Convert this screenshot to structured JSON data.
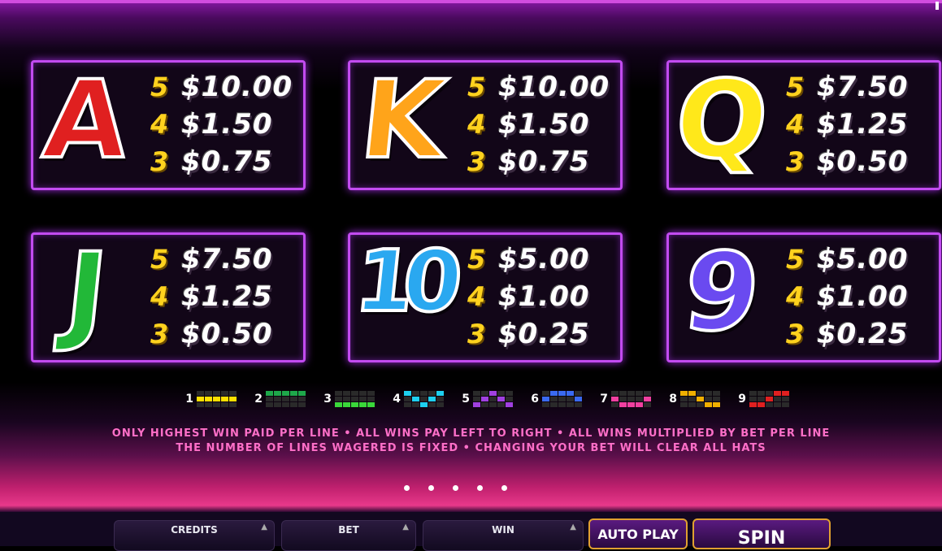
{
  "paytable": [
    {
      "symbol": "A",
      "color": "#e02020",
      "pays": [
        {
          "count": "5",
          "amount": "$10.00"
        },
        {
          "count": "4",
          "amount": "$1.50"
        },
        {
          "count": "3",
          "amount": "$0.75"
        }
      ]
    },
    {
      "symbol": "K",
      "color": "#ffa41a",
      "pays": [
        {
          "count": "5",
          "amount": "$10.00"
        },
        {
          "count": "4",
          "amount": "$1.50"
        },
        {
          "count": "3",
          "amount": "$0.75"
        }
      ]
    },
    {
      "symbol": "Q",
      "color": "#ffe81a",
      "pays": [
        {
          "count": "5",
          "amount": "$7.50"
        },
        {
          "count": "4",
          "amount": "$1.25"
        },
        {
          "count": "3",
          "amount": "$0.50"
        }
      ]
    },
    {
      "symbol": "J",
      "color": "#22b838",
      "pays": [
        {
          "count": "5",
          "amount": "$7.50"
        },
        {
          "count": "4",
          "amount": "$1.25"
        },
        {
          "count": "3",
          "amount": "$0.50"
        }
      ]
    },
    {
      "symbol": "10",
      "color": "#2aa8f0",
      "pays": [
        {
          "count": "5",
          "amount": "$5.00"
        },
        {
          "count": "4",
          "amount": "$1.00"
        },
        {
          "count": "3",
          "amount": "$0.25"
        }
      ]
    },
    {
      "symbol": "9",
      "color": "#6a4af0",
      "pays": [
        {
          "count": "5",
          "amount": "$5.00"
        },
        {
          "count": "4",
          "amount": "$1.00"
        },
        {
          "count": "3",
          "amount": "$0.25"
        }
      ]
    }
  ],
  "paylines": [
    {
      "number": "1",
      "color": "#ffe000",
      "pattern": [
        1,
        1,
        1,
        1,
        1
      ]
    },
    {
      "number": "2",
      "color": "#1ea84a",
      "pattern": [
        0,
        0,
        0,
        0,
        0
      ]
    },
    {
      "number": "3",
      "color": "#3ad83a",
      "pattern": [
        2,
        2,
        2,
        2,
        2
      ]
    },
    {
      "number": "4",
      "color": "#1ed0f0",
      "pattern": [
        0,
        1,
        2,
        1,
        0
      ]
    },
    {
      "number": "5",
      "color": "#a040e0",
      "pattern": [
        2,
        1,
        0,
        1,
        2
      ]
    },
    {
      "number": "6",
      "color": "#3a6af0",
      "pattern": [
        1,
        0,
        0,
        0,
        1
      ]
    },
    {
      "number": "7",
      "color": "#f040a0",
      "pattern": [
        1,
        2,
        2,
        2,
        1
      ]
    },
    {
      "number": "8",
      "color": "#f0b000",
      "pattern": [
        0,
        0,
        1,
        2,
        2
      ]
    },
    {
      "number": "9",
      "color": "#e02020",
      "pattern": [
        2,
        2,
        1,
        0,
        0
      ]
    }
  ],
  "rules": {
    "line1": "ONLY HIGHEST WIN PAID PER LINE • ALL WINS PAY LEFT TO RIGHT • ALL WINS MULTIPLIED BY BET PER LINE",
    "line2": "THE NUMBER OF LINES WAGERED IS FIXED • CHANGING YOUR BET WILL CLEAR ALL HATS"
  },
  "pagination": {
    "pages": 5
  },
  "controls": {
    "credits_label": "CREDITS",
    "bet_label": "BET",
    "win_label": "WIN",
    "autoplay_label": "AUTO PLAY",
    "spin_label": "SPIN"
  }
}
